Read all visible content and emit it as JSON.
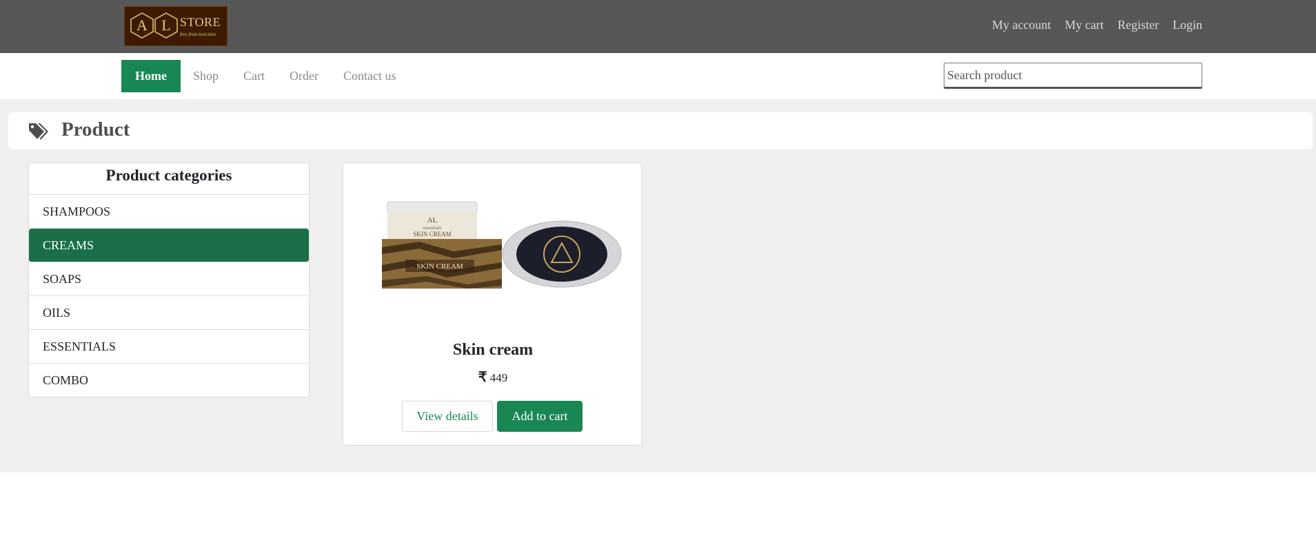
{
  "header": {
    "logo_letters": [
      "A",
      "L"
    ],
    "logo_store": "STORE",
    "logo_tagline": "free from toxicities",
    "account_links": [
      "My account",
      "My cart",
      "Register",
      "Login"
    ]
  },
  "nav": {
    "items": [
      "Home",
      "Shop",
      "Cart",
      "Order",
      "Contact us"
    ],
    "active": "Home",
    "search_placeholder": "Search product"
  },
  "page": {
    "title": "Product",
    "icon": "tags-icon"
  },
  "categories": {
    "heading": "Product categories",
    "items": [
      "SHAMPOOS",
      "CREAMS",
      "SOAPS",
      "OILS",
      "ESSENTIALS",
      "COMBO"
    ],
    "active": "CREAMS"
  },
  "product": {
    "name": "Skin cream",
    "currency_symbol": "₹",
    "price": "449",
    "image_labels": [
      "AL",
      "essentials",
      "SKIN CREAM"
    ],
    "view_label": "View details",
    "add_label": "Add to cart"
  },
  "colors": {
    "accent": "#198754",
    "active_category": "#1a6f48",
    "topbar": "#575757",
    "background": "#efefef"
  }
}
